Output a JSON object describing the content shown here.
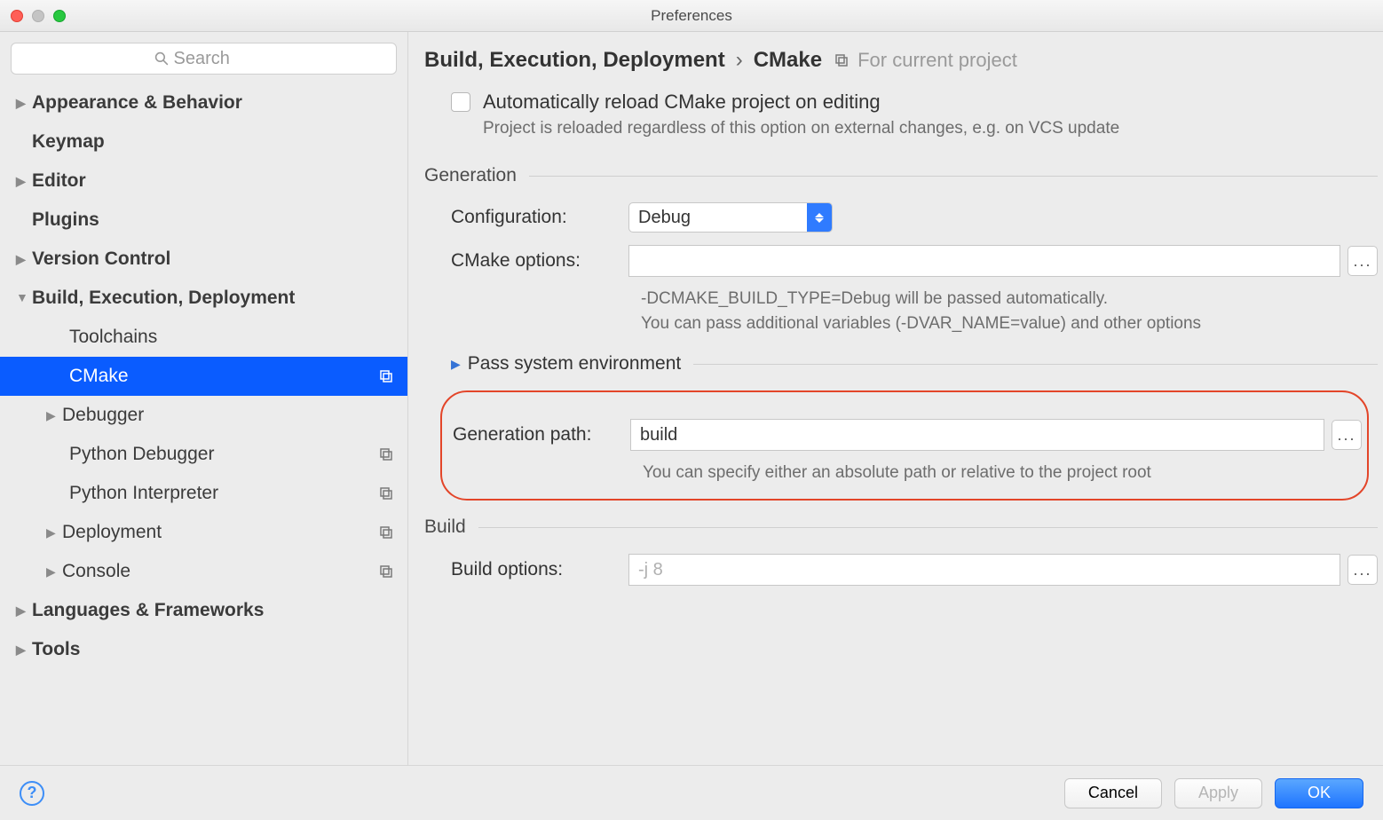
{
  "window": {
    "title": "Preferences"
  },
  "search": {
    "placeholder": "Search"
  },
  "sidebar": {
    "items": [
      {
        "label": "Appearance & Behavior"
      },
      {
        "label": "Keymap"
      },
      {
        "label": "Editor"
      },
      {
        "label": "Plugins"
      },
      {
        "label": "Version Control"
      },
      {
        "label": "Build, Execution, Deployment"
      },
      {
        "label": "Toolchains"
      },
      {
        "label": "CMake"
      },
      {
        "label": "Debugger"
      },
      {
        "label": "Python Debugger"
      },
      {
        "label": "Python Interpreter"
      },
      {
        "label": "Deployment"
      },
      {
        "label": "Console"
      },
      {
        "label": "Languages & Frameworks"
      },
      {
        "label": "Tools"
      }
    ]
  },
  "breadcrumb": {
    "parent": "Build, Execution, Deployment",
    "current": "CMake",
    "hint": "For current project"
  },
  "autoReload": {
    "label": "Automatically reload CMake project on editing",
    "note": "Project is reloaded regardless of this option on external changes, e.g. on VCS update"
  },
  "sections": {
    "generation": "Generation",
    "passenv": "Pass system environment",
    "build": "Build"
  },
  "form": {
    "configuration_label": "Configuration:",
    "configuration_value": "Debug",
    "cmake_options_label": "CMake options:",
    "cmake_options_value": "",
    "cmake_hint1": "-DCMAKE_BUILD_TYPE=Debug will be passed automatically.",
    "cmake_hint2": "You can pass additional variables (-DVAR_NAME=value) and other options",
    "genpath_label": "Generation path:",
    "genpath_value": "build",
    "genpath_hint": "You can specify either an absolute path or relative to the project root",
    "buildopts_label": "Build options:",
    "buildopts_placeholder": "-j 8",
    "buildopts_value": ""
  },
  "footer": {
    "cancel": "Cancel",
    "apply": "Apply",
    "ok": "OK"
  }
}
